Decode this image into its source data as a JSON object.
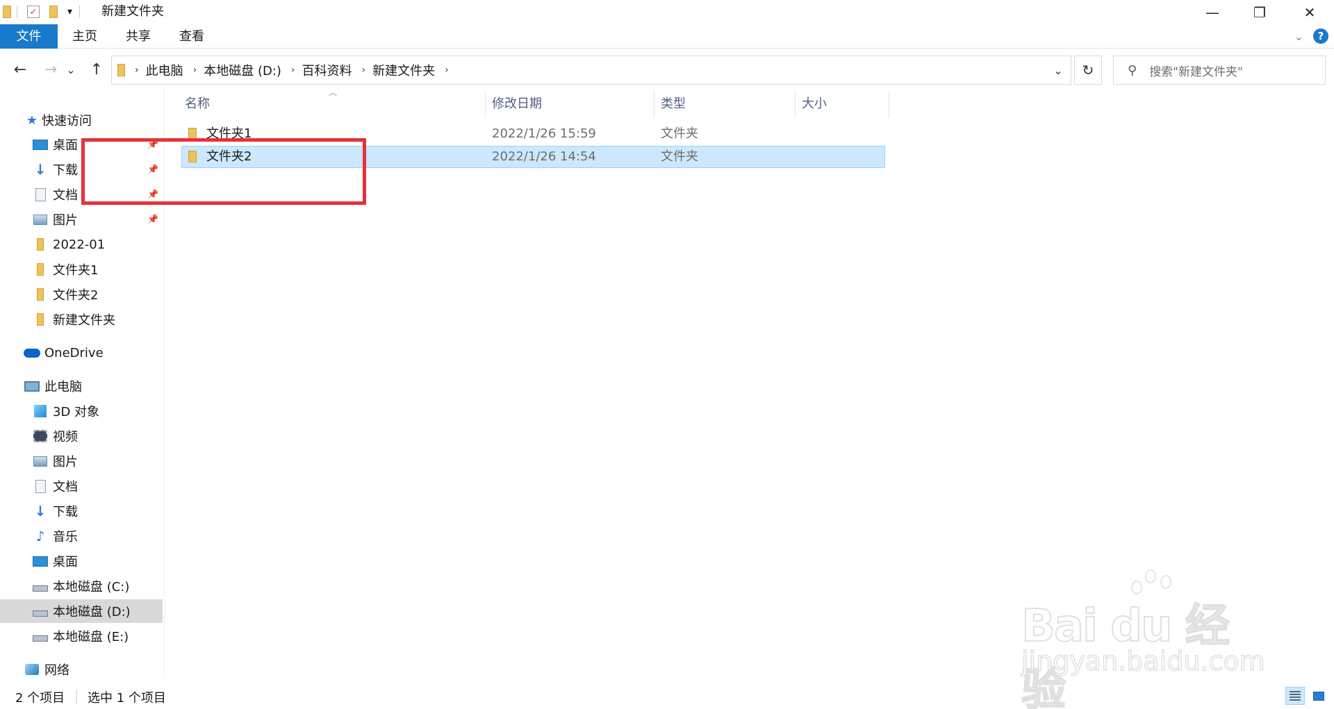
{
  "window": {
    "title": "新建文件夹",
    "qa_dropdown": "▾",
    "minimize": "—",
    "maximize": "❐",
    "close": "✕"
  },
  "ribbon": {
    "tabs": [
      "文件",
      "主页",
      "共享",
      "查看"
    ],
    "help": "?"
  },
  "nav": {
    "back": "←",
    "forward": "→",
    "recent": "⌄",
    "up": "↑",
    "breadcrumb": [
      "此电脑",
      "本地磁盘 (D:)",
      "百科资料",
      "新建文件夹"
    ],
    "refresh": "↻",
    "search_placeholder": "搜索\"新建文件夹\""
  },
  "sidebar": {
    "quick_access": "快速访问",
    "quick_items": [
      {
        "label": "桌面",
        "pinned": true
      },
      {
        "label": "下载",
        "pinned": true
      },
      {
        "label": "文档",
        "pinned": true
      },
      {
        "label": "图片",
        "pinned": true
      },
      {
        "label": "2022-01",
        "pinned": false
      },
      {
        "label": "文件夹1",
        "pinned": false
      },
      {
        "label": "文件夹2",
        "pinned": false
      },
      {
        "label": "新建文件夹",
        "pinned": false
      }
    ],
    "onedrive": "OneDrive",
    "this_pc": "此电脑",
    "pc_items": [
      "3D 对象",
      "视频",
      "图片",
      "文档",
      "下载",
      "音乐",
      "桌面",
      "本地磁盘 (C:)",
      "本地磁盘 (D:)",
      "本地磁盘 (E:)"
    ],
    "selected_pc_item": "本地磁盘 (D:)",
    "network": "网络"
  },
  "columns": {
    "name": "名称",
    "date": "修改日期",
    "type": "类型",
    "size": "大小"
  },
  "files": [
    {
      "name": "文件夹1",
      "date": "2022/1/26 15:59",
      "type": "文件夹",
      "selected": false
    },
    {
      "name": "文件夹2",
      "date": "2022/1/26 14:54",
      "type": "文件夹",
      "selected": true
    }
  ],
  "status": {
    "count": "2 个项目",
    "selection": "选中 1 个项目"
  },
  "watermark": {
    "brand": "Bai du 经验",
    "url": "jingyan.baidu.com"
  },
  "colors": {
    "accent": "#1979ca",
    "selection": "#cce8ff",
    "highlight_box": "#e8313a",
    "folder": "#f0c25a"
  }
}
